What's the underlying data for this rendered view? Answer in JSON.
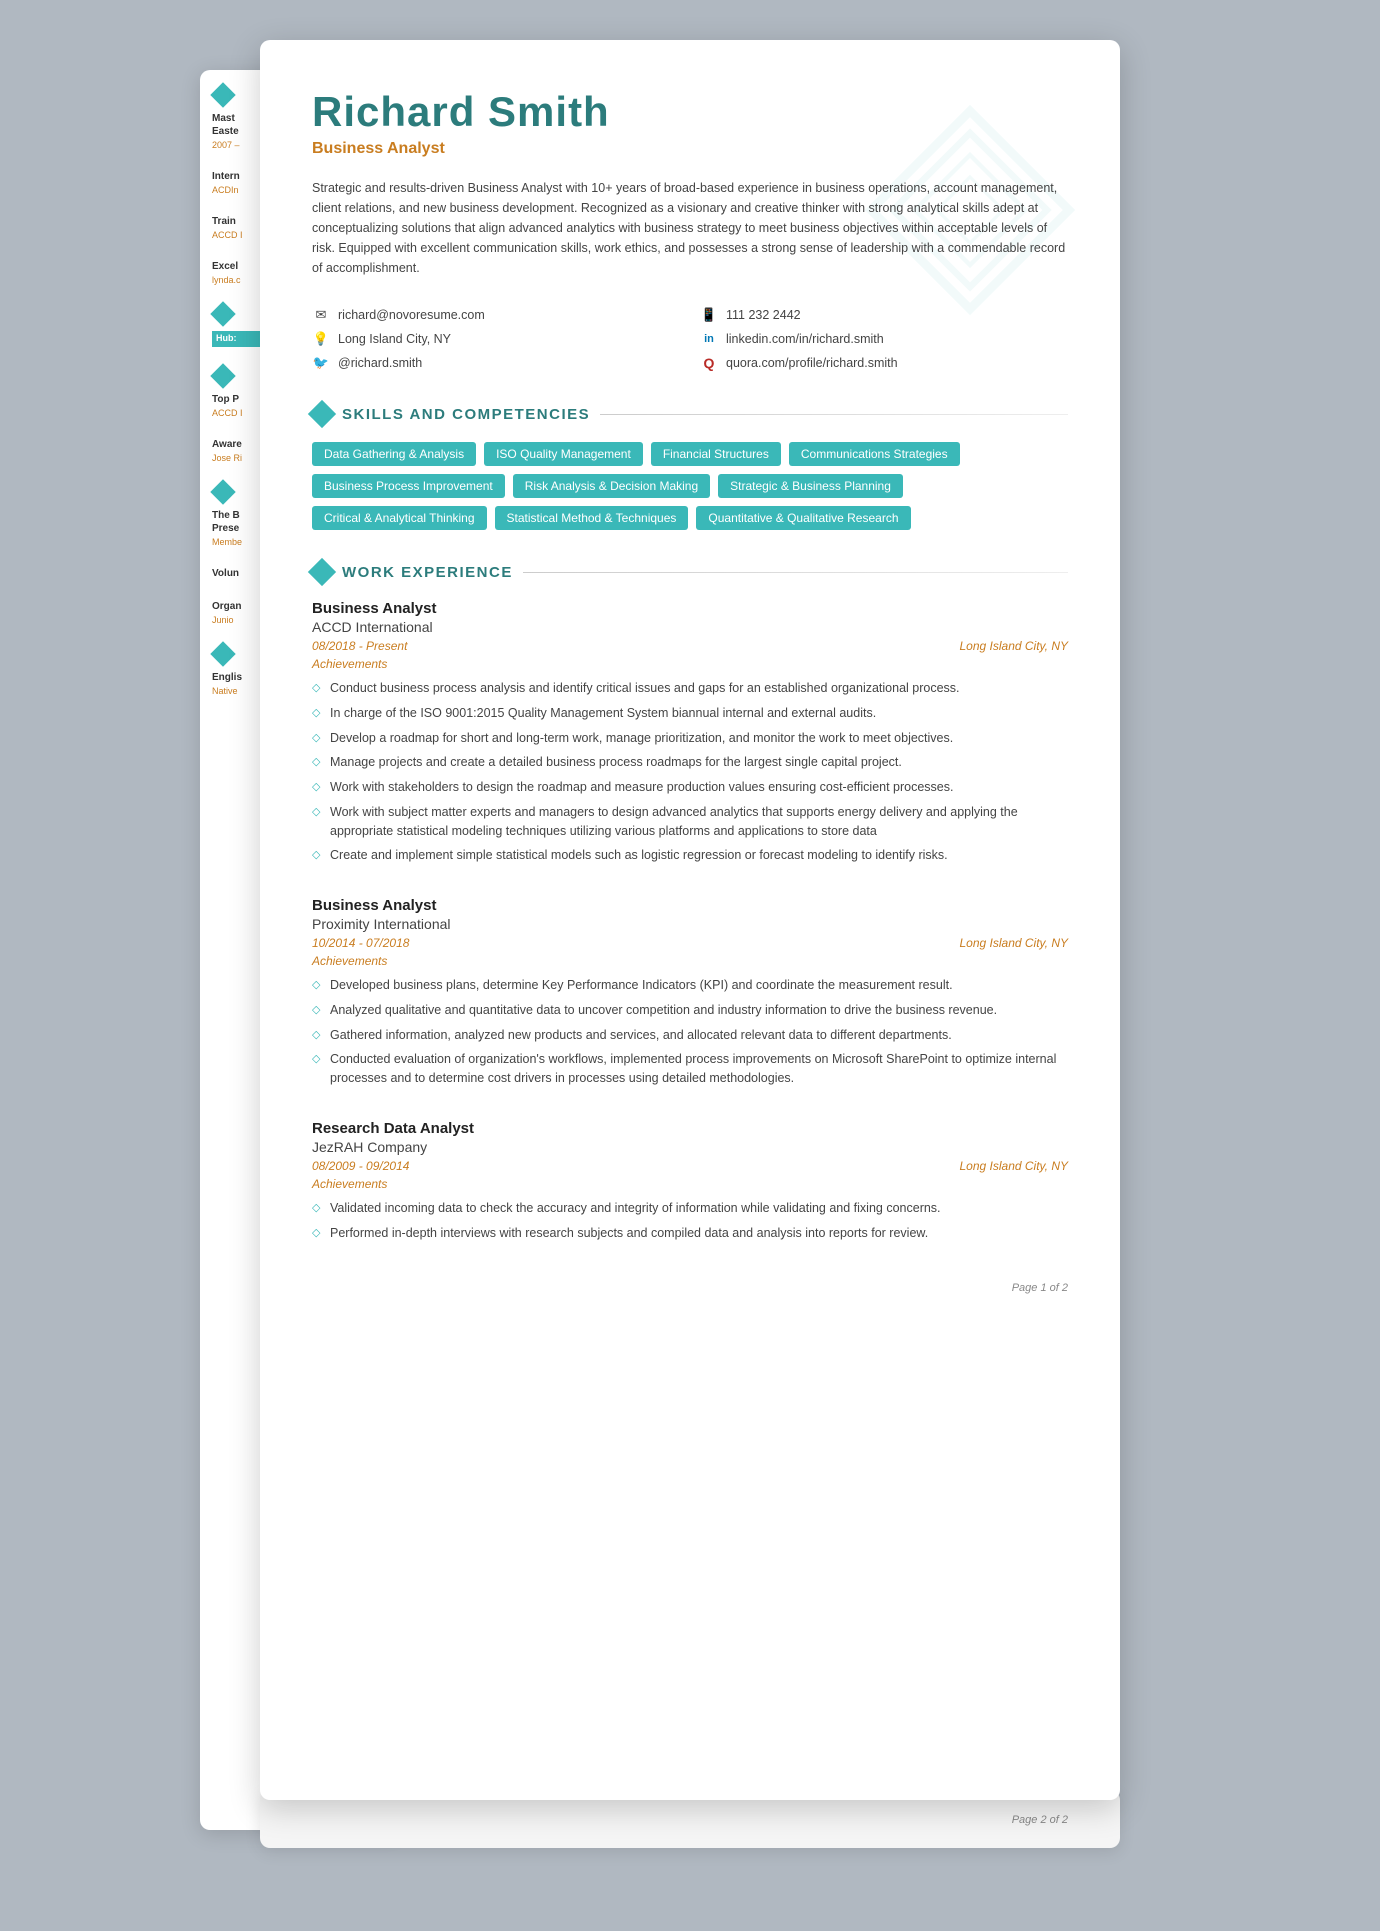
{
  "resume": {
    "name": "Richard Smith",
    "job_title": "Business Analyst",
    "summary": "Strategic and results-driven Business Analyst with 10+ years of broad-based experience in business operations, account management, client relations, and new business development. Recognized as a visionary and creative thinker with strong analytical skills adept at conceptualizing solutions that align advanced analytics with business strategy to meet business objectives within acceptable levels of risk. Equipped with excellent communication skills, work ethics, and possesses a strong sense of leadership with a commendable record of accomplishment.",
    "contact": {
      "email": "richard@novoresume.com",
      "location": "Long Island City, NY",
      "twitter": "@richard.smith",
      "phone": "111 232 2442",
      "linkedin": "linkedin.com/in/richard.smith",
      "quora": "quora.com/profile/richard.smith"
    },
    "sections": {
      "skills_title": "SKILLS AND COMPETENCIES",
      "work_title": "WORK EXPERIENCE"
    },
    "skills": [
      "Data Gathering & Analysis",
      "ISO Quality Management",
      "Financial Structures",
      "Communications Strategies",
      "Business Process Improvement",
      "Risk Analysis & Decision Making",
      "Strategic & Business Planning",
      "Critical & Analytical Thinking",
      "Statistical Method & Techniques",
      "Quantitative & Qualitative Research"
    ],
    "work_experience": [
      {
        "title": "Business Analyst",
        "company": "ACCD International",
        "dates": "08/2018 - Present",
        "location": "Long Island City, NY",
        "achievements_label": "Achievements",
        "achievements": [
          "Conduct business process analysis and identify critical issues and gaps for an established organizational process.",
          "In charge of the ISO 9001:2015 Quality Management System biannual internal and external audits.",
          "Develop a roadmap for short and long-term work, manage prioritization, and monitor the work to meet objectives.",
          "Manage projects and create a detailed business process roadmaps for the largest single capital project.",
          "Work with stakeholders to design the roadmap and measure production values ensuring cost-efficient processes.",
          "Work with subject matter experts and managers to design advanced analytics that supports energy delivery and applying the appropriate statistical modeling techniques utilizing various platforms and applications to store data",
          "Create and implement simple statistical models such as logistic regression or forecast modeling to identify risks."
        ]
      },
      {
        "title": "Business Analyst",
        "company": "Proximity International",
        "dates": "10/2014 - 07/2018",
        "location": "Long Island City, NY",
        "achievements_label": "Achievements",
        "achievements": [
          "Developed business plans, determine Key Performance Indicators (KPI) and coordinate the measurement result.",
          "Analyzed qualitative and quantitative data to uncover competition and industry information to drive the business revenue.",
          "Gathered information, analyzed new products and services, and allocated relevant data to different departments.",
          "Conducted evaluation of organization's workflows, implemented process improvements on Microsoft SharePoint to optimize internal processes and to determine cost drivers in processes using detailed methodologies."
        ]
      },
      {
        "title": "Research Data Analyst",
        "company": "JezRAH Company",
        "dates": "08/2009 - 09/2014",
        "location": "Long Island City, NY",
        "achievements_label": "Achievements",
        "achievements": [
          "Validated incoming data to check the accuracy and integrity of information while validating and fixing concerns.",
          "Performed in-depth interviews with research subjects and compiled data and analysis into reports for review."
        ]
      }
    ],
    "page1_number": "Page 1 of 2",
    "page2_number": "Page 2 of 2"
  },
  "sidebar": {
    "items": [
      {
        "title": "Mast",
        "sub": "Easte",
        "date": "2007 -"
      },
      {
        "title": "Intern",
        "sub": "ACDIn"
      },
      {
        "title": "Train",
        "sub": "ACCD I"
      },
      {
        "title": "Excel",
        "sub": "lynda.c"
      },
      {
        "title": "Hub:",
        "sub": ""
      },
      {
        "title": "Top P",
        "sub": "ACCD I"
      },
      {
        "title": "Aware",
        "sub": "Jose Ri"
      },
      {
        "title": "The B",
        "sub": "Prese",
        "date3": "Membe"
      },
      {
        "title": "Volun",
        "sub": ""
      },
      {
        "title": "Organ",
        "sub": "Junio"
      },
      {
        "title": "Englis",
        "sub": "Native"
      }
    ]
  }
}
